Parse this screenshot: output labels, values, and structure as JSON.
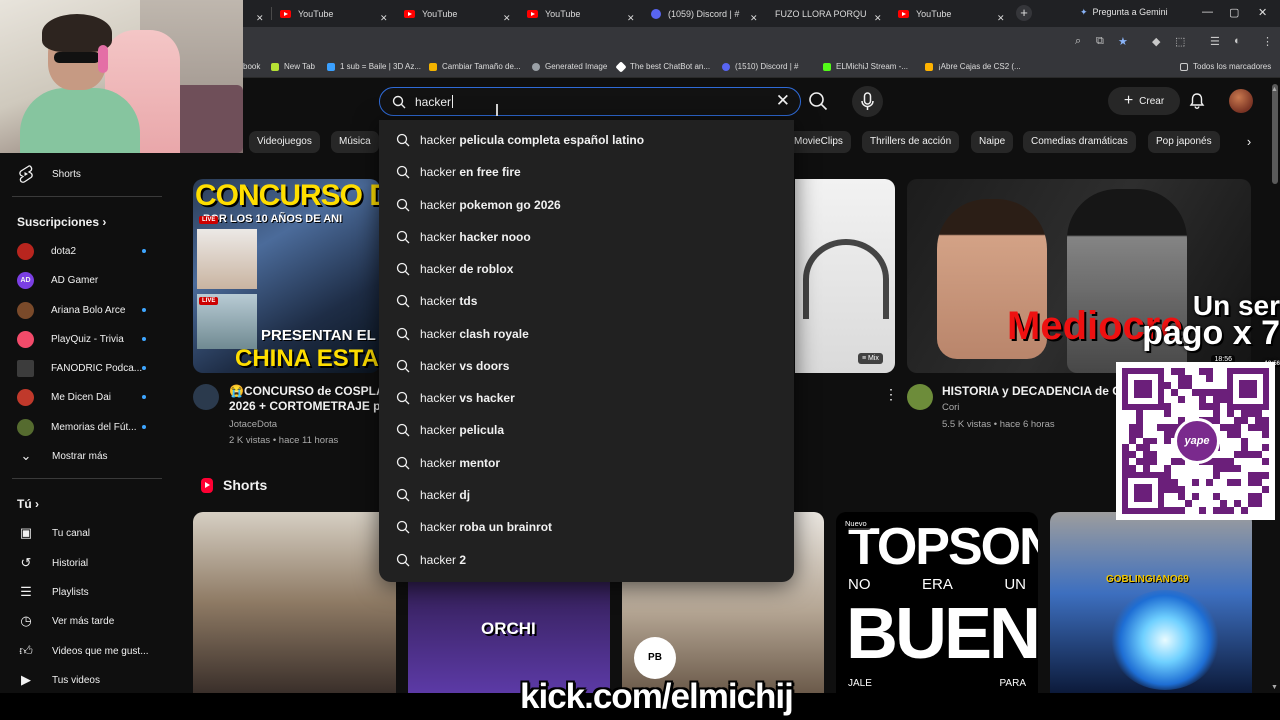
{
  "browser": {
    "tabs": [
      {
        "title": "YouTube",
        "favicon": "youtube-icon"
      },
      {
        "title": "YouTube",
        "favicon": "youtube-icon"
      },
      {
        "title": "YouTube",
        "favicon": "youtube-icon"
      },
      {
        "title": "(1059) Discord | #",
        "favicon": "discord-icon"
      },
      {
        "title": "FUZO LLORA PORQU",
        "favicon": "youtube-icon"
      },
      {
        "title": "YouTube",
        "favicon": "youtube-icon"
      }
    ],
    "gemini_label": "Pregunta a Gemini",
    "bookmarks": [
      {
        "label": "book",
        "color": "#1877f2"
      },
      {
        "label": "New Tab",
        "color": "#b6e234"
      },
      {
        "label": "1 sub = Baile | 3D Az...",
        "color": "#3aa0ff"
      },
      {
        "label": "Cambiar Tamaño de...",
        "color": "#f4b400"
      },
      {
        "label": "Generated Image",
        "color": "#9aa0a6"
      },
      {
        "label": "The best ChatBot an...",
        "color": "#ffffff"
      },
      {
        "label": "(1510) Discord | #",
        "color": "#5865f2"
      },
      {
        "label": "ELMichiJ Stream -...",
        "color": "#53fc18"
      },
      {
        "label": "¡Abre Cajas de CS2 (...",
        "color": "#ffb300"
      }
    ],
    "bookmarks_folder": "Todos los marcadores"
  },
  "youtube": {
    "search": {
      "value": "hacker",
      "suggestions": [
        {
          "prefix": "hacker",
          "rest": " pelicula completa español latino"
        },
        {
          "prefix": "hacker",
          "rest": " en free fire"
        },
        {
          "prefix": "hacker",
          "rest": " pokemon go 2026"
        },
        {
          "prefix": "hacker",
          "rest": " hacker nooo"
        },
        {
          "prefix": "hacker",
          "rest": " de roblox"
        },
        {
          "prefix": "hacker",
          "rest": " tds"
        },
        {
          "prefix": "hacker",
          "rest": " clash royale"
        },
        {
          "prefix": "hacker",
          "rest": " vs doors"
        },
        {
          "prefix": "hacker",
          "rest": " vs hacker"
        },
        {
          "prefix": "hacker",
          "rest": " pelicula"
        },
        {
          "prefix": "hacker",
          "rest": " mentor"
        },
        {
          "prefix": "hacker",
          "rest": " dj"
        },
        {
          "prefix": "hacker",
          "rest": " roba un brainrot"
        },
        {
          "prefix": "hacker",
          "rest": " 2"
        }
      ]
    },
    "create_label": "Crear",
    "chips": [
      "Videojuegos",
      "Música",
      "MovieClips",
      "Thrillers de acción",
      "Naipe",
      "Comedias dramáticas",
      "Pop japonés"
    ],
    "sidebar": {
      "shorts_label": "Shorts",
      "subscriptions_heading": "Suscripciones",
      "channels": [
        {
          "name": "dota2",
          "color": "#b8251e",
          "dot": true
        },
        {
          "name": "AD Gamer",
          "color": "#7b3fe4",
          "dot": false
        },
        {
          "name": "Ariana Bolo Arce",
          "color": "#7a4a2a",
          "dot": true
        },
        {
          "name": "PlayQuiz - Trivia",
          "color": "#f24b6a",
          "dot": true
        },
        {
          "name": "FANODRIC Podca...",
          "color": "#3c3c3c",
          "dot": true
        },
        {
          "name": "Me Dicen Dai",
          "color": "#c0392b",
          "dot": true
        },
        {
          "name": "Memorias del Fút...",
          "color": "#556b2f",
          "dot": true
        }
      ],
      "show_more": "Mostrar más",
      "you_heading": "Tú",
      "you_items": [
        {
          "label": "Tu canal",
          "icon": "channel-icon"
        },
        {
          "label": "Historial",
          "icon": "history-icon"
        },
        {
          "label": "Playlists",
          "icon": "playlists-icon"
        },
        {
          "label": "Ver más tarde",
          "icon": "watch-later-icon"
        },
        {
          "label": "Videos que me gust...",
          "icon": "like-icon"
        },
        {
          "label": "Tus videos",
          "icon": "your-videos-icon"
        }
      ]
    },
    "videos": [
      {
        "thumb_title": "CONCURSO D",
        "thumb_sub": "POR LOS 10 AÑOS DE ANI",
        "thumb_bottom1": "PRESENTAN EL",
        "thumb_bottom2": "CHINA ESTA",
        "live_badge": "LIVE",
        "title_line1": "😭CONCURSO de COSPLAY",
        "title_line2": "2026 + CORTOMETRAJE  po",
        "channel": "JotaceDota",
        "meta": "2 K vistas • hace 11 horas"
      },
      {
        "mix_badge": "Mix"
      },
      {
        "thumb_red": "Mediocre",
        "thumb_white": "Un ser",
        "duration": "18:56",
        "title": "HISTORIA y DECADENCIA de CU",
        "channel": "Cori",
        "meta": "5.5 K vistas • hace 6 horas"
      }
    ],
    "shorts_heading": "Shorts",
    "shorts": [
      {
        "text": ""
      },
      {
        "text": "ORCHI"
      },
      {
        "text": ""
      },
      {
        "badge": "Nuevo",
        "line1": "TOPSON",
        "line2a": "NO",
        "line2b": "ERA",
        "line2c": "UN",
        "line3": "BUEN",
        "line4a": "JALE",
        "line4b": "PARA"
      },
      {
        "text": "GOBLINGIANO69"
      }
    ]
  },
  "stream_overlay": {
    "qr_brand": "yape",
    "text_line1": "Un ser",
    "text_line2": "pago x 7",
    "kick_url": "kick.com/elmichij",
    "pb_logo": "PB"
  },
  "colors": {
    "background": "#0f0f0f",
    "accent_blue": "#3ea6ff",
    "search_border": "#2f6bd8",
    "youtube_red": "#ff0000"
  }
}
